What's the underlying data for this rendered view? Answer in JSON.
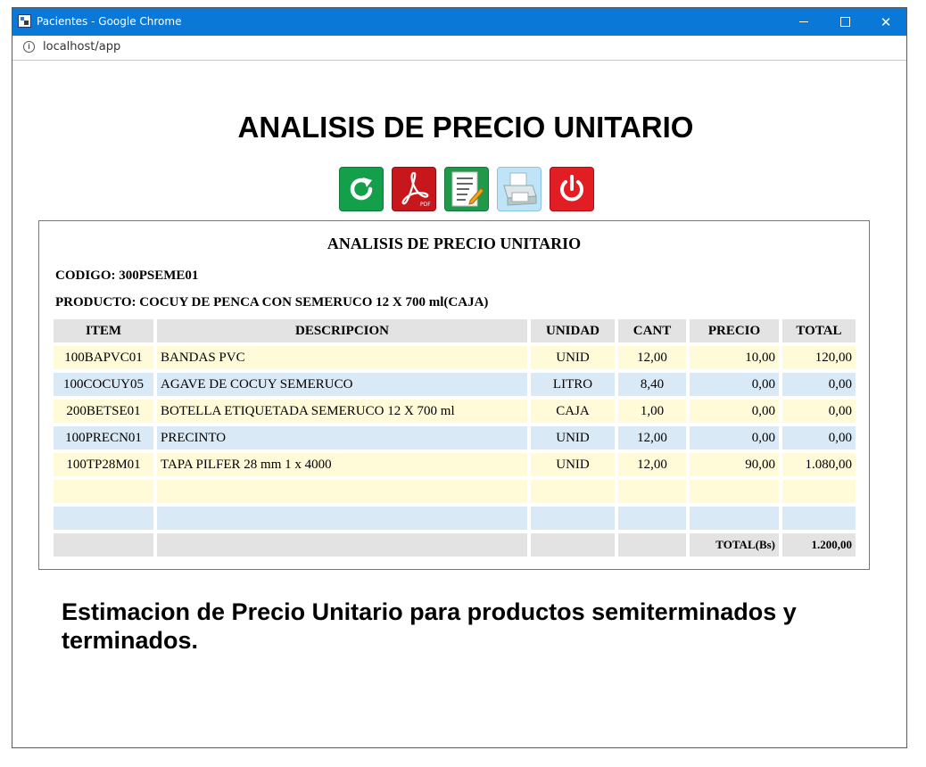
{
  "window": {
    "title": "Pacientes - Google Chrome",
    "url": "localhost/app"
  },
  "page": {
    "title": "ANALISIS DE PRECIO UNITARIO",
    "caption": "Estimacion de Precio Unitario para productos semiterminados y terminados."
  },
  "toolbar": {
    "buttons": [
      {
        "icon": "refresh-icon",
        "color": "#14a04a"
      },
      {
        "icon": "pdf-icon",
        "color": "#c8161d"
      },
      {
        "icon": "document-edit-icon",
        "color": "#1f9a4a"
      },
      {
        "icon": "printer-icon",
        "color": "#bfe3f7"
      },
      {
        "icon": "power-icon",
        "color": "#e21d24"
      }
    ]
  },
  "report": {
    "title": "ANALISIS DE PRECIO UNITARIO",
    "code": "CODIGO: 300PSEME01",
    "product": "PRODUCTO: COCUY DE PENCA CON SEMERUCO 12 X 700 ml(CAJA)",
    "headers": [
      "ITEM",
      "DESCRIPCION",
      "UNIDAD",
      "CANT",
      "PRECIO",
      "TOTAL"
    ],
    "rows": [
      {
        "item": "100BAPVC01",
        "desc": "BANDAS PVC",
        "unit": "UNID",
        "cant": "12,00",
        "precio": "10,00",
        "total": "120,00"
      },
      {
        "item": "100COCUY05",
        "desc": "AGAVE DE COCUY SEMERUCO",
        "unit": "LITRO",
        "cant": "8,40",
        "precio": "0,00",
        "total": "0,00"
      },
      {
        "item": "200BETSE01",
        "desc": "BOTELLA ETIQUETADA SEMERUCO 12 X 700 ml",
        "unit": "CAJA",
        "cant": "1,00",
        "precio": "0,00",
        "total": "0,00"
      },
      {
        "item": "100PRECN01",
        "desc": "PRECINTO",
        "unit": "UNID",
        "cant": "12,00",
        "precio": "0,00",
        "total": "0,00"
      },
      {
        "item": "100TP28M01",
        "desc": "TAPA PILFER 28 mm 1 x 4000",
        "unit": "UNID",
        "cant": "12,00",
        "precio": "90,00",
        "total": "1.080,00"
      }
    ],
    "total_label": "TOTAL(Bs)",
    "total_value": "1.200,00"
  },
  "colors": {
    "titlebar": "#0a78d7",
    "row_yellow": "#fffad7",
    "row_blue": "#d9eaf6",
    "header_gray": "#e3e3e3"
  }
}
